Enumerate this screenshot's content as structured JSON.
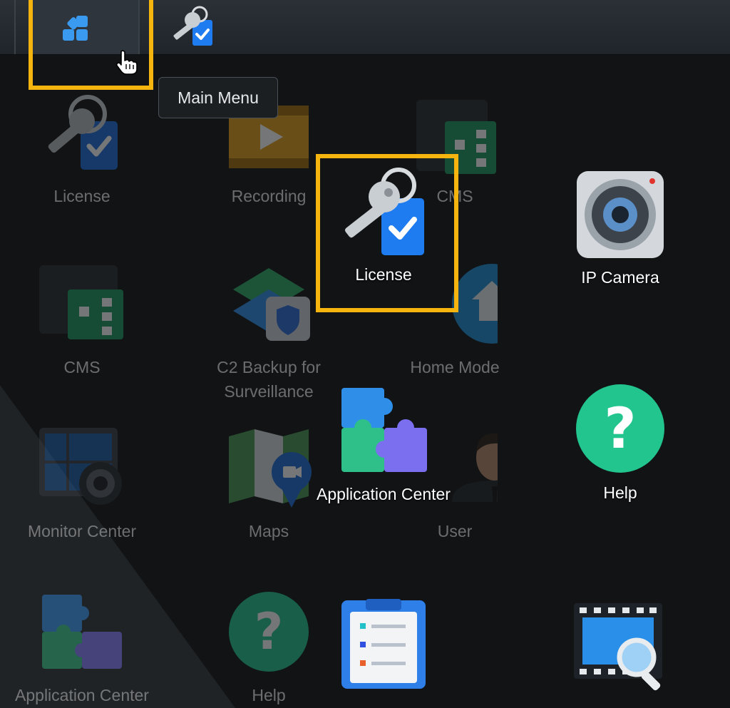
{
  "taskbar": {
    "main_menu_icon": "grid-icon",
    "pinned_app_icon": "license-key-icon"
  },
  "tooltip": {
    "text": "Main Menu"
  },
  "background_desktop": {
    "items": [
      {
        "label": "License",
        "icon": "license-key-icon"
      },
      {
        "label": "Recording",
        "icon": "recording-film-icon"
      },
      {
        "label": "CMS",
        "icon": "cms-server-icon"
      },
      {
        "label": "CMS",
        "icon": "cms-server-icon"
      },
      {
        "label": "C2 Backup for\nSurveillance",
        "icon": "c2-backup-icon"
      },
      {
        "label": "Home Mode",
        "icon": "home-mode-icon"
      },
      {
        "label": "Monitor Center",
        "icon": "monitor-center-icon"
      },
      {
        "label": "Maps",
        "icon": "maps-icon"
      },
      {
        "label": "User",
        "icon": "user-icon"
      },
      {
        "label": "Application Center",
        "icon": "puzzle-icon"
      },
      {
        "label": "Help",
        "icon": "help-icon"
      }
    ]
  },
  "foreground_menu": {
    "items": [
      {
        "label": "License",
        "icon": "license-key-icon"
      },
      {
        "label": "IP Camera",
        "icon": "ip-camera-icon"
      },
      {
        "label": "Application Center",
        "icon": "puzzle-icon"
      },
      {
        "label": "Help",
        "icon": "help-icon"
      },
      {
        "label": "",
        "icon": "log-list-icon"
      },
      {
        "label": "",
        "icon": "video-search-icon"
      }
    ]
  },
  "colors": {
    "highlight": "#f6b40f",
    "accent_blue": "#2f8fe8",
    "help_green": "#22c58e"
  }
}
